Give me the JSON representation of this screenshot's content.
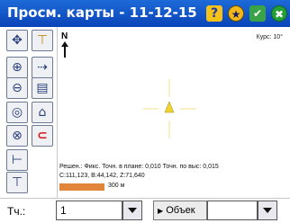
{
  "window": {
    "title": "Просм. карты - 11-12-15",
    "help_glyph": "?",
    "ok_glyph": "✔",
    "close_glyph": "✖"
  },
  "map": {
    "north_label": "N",
    "heading_readout": "Курс: 10°",
    "status_line1": "Решен.: Фикс.  Точн. в плане: 0,010  Точн. по выс: 0,015",
    "status_line2": "С:111,123, В:44,142, Z:71,640",
    "scale_label": "300 м",
    "accent_color": "#f2d22e",
    "scale_color": "#e0853a"
  },
  "bottom": {
    "point_label": "Тч.:",
    "point_value": "1",
    "object_button_label": "Объек",
    "object_value": ""
  },
  "toolbar": {
    "tools": [
      "pan-icon",
      "level-icon",
      "zoom-in-icon",
      "route-icon",
      "zoom-out-icon",
      "layers-icon",
      "zoom-extent-icon",
      "surface-icon",
      "zoom-window-icon",
      "magnet-icon",
      "add-point-icon",
      "tilt-icon"
    ]
  }
}
